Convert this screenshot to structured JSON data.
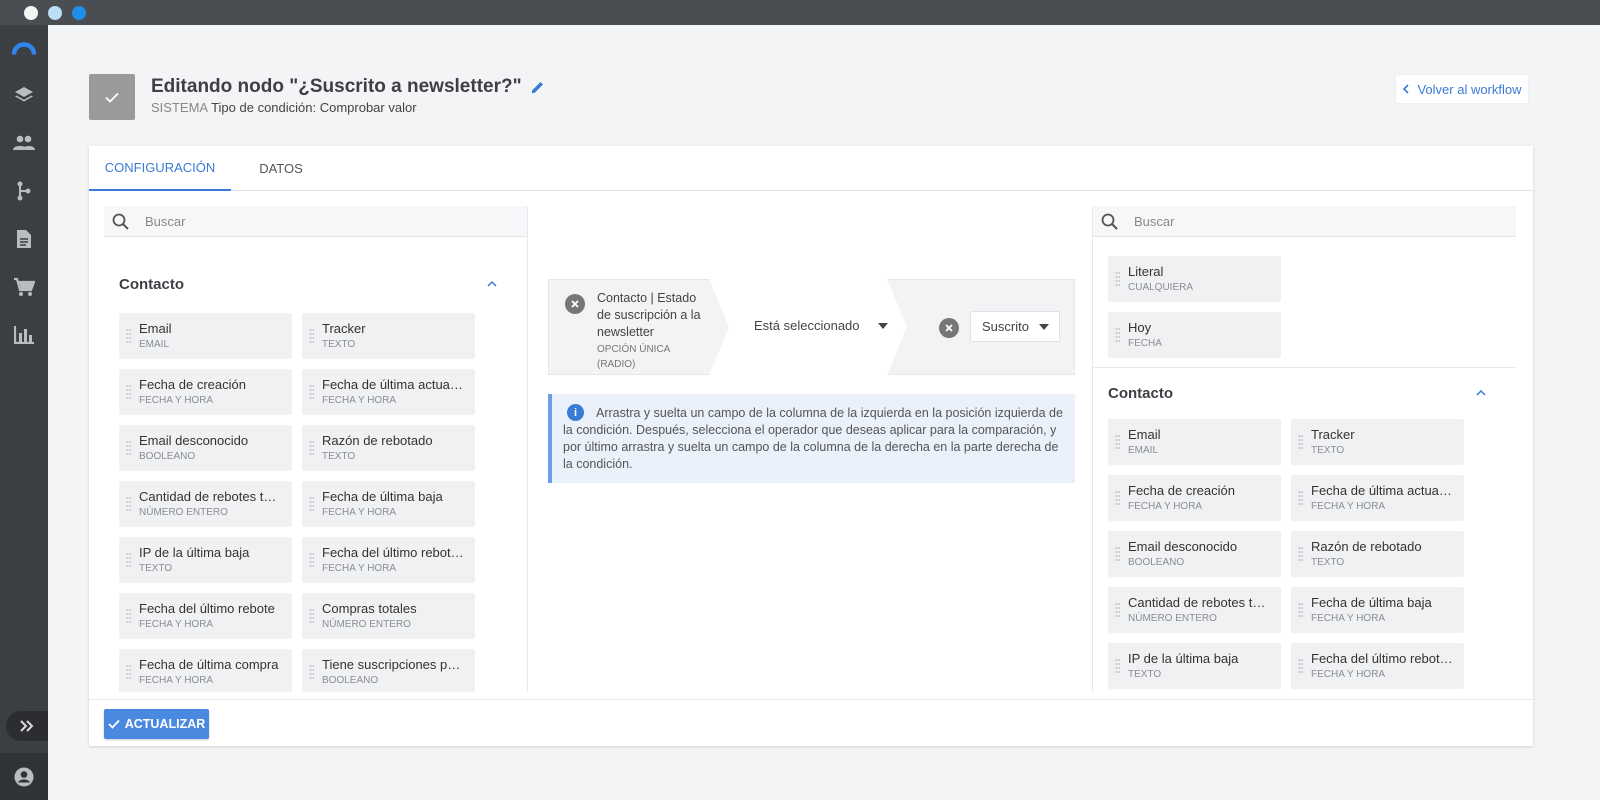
{
  "header": {
    "title": "Editando nodo \"¿Suscrito a newsletter?\"",
    "system_label": "SISTEMA",
    "condition_type": "Tipo de condición: Comprobar valor",
    "back_label": "Volver al workflow"
  },
  "tabs": [
    {
      "label": "CONFIGURACIÓN",
      "active": true
    },
    {
      "label": "DATOS",
      "active": false
    }
  ],
  "left_panel": {
    "search_placeholder": "Buscar",
    "group_title": "Contacto",
    "fields": [
      {
        "label": "Email",
        "type": "EMAIL"
      },
      {
        "label": "Tracker",
        "type": "TEXTO"
      },
      {
        "label": "Fecha de creación",
        "type": "FECHA Y HORA"
      },
      {
        "label": "Fecha de última actualización",
        "type": "FECHA Y HORA"
      },
      {
        "label": "Email desconocido",
        "type": "BOOLEANO"
      },
      {
        "label": "Razón de rebotado",
        "type": "TEXTO"
      },
      {
        "label": "Cantidad de rebotes temporales",
        "type": "NÚMERO ENTERO"
      },
      {
        "label": "Fecha de última baja",
        "type": "FECHA Y HORA"
      },
      {
        "label": "IP de la última baja",
        "type": "TEXTO"
      },
      {
        "label": "Fecha del último rebote temporal",
        "type": "FECHA Y HORA"
      },
      {
        "label": "Fecha del último rebote",
        "type": "FECHA Y HORA"
      },
      {
        "label": "Compras totales",
        "type": "NÚMERO ENTERO"
      },
      {
        "label": "Fecha de última compra",
        "type": "FECHA Y HORA"
      },
      {
        "label": "Tiene suscripciones pendientes",
        "type": "BOOLEANO"
      }
    ]
  },
  "condition": {
    "left_field": "Contacto | Estado de suscripción a la newsletter",
    "left_type": "OPCIÓN ÚNICA (RADIO)",
    "operator": "Está seleccionado",
    "value": "Suscrito"
  },
  "info_text": "Arrastra y suelta un campo de la columna de la izquierda en la posición izquierda de la condición. Después, selecciona el operador que deseas aplicar para la comparación, y por último arrastra y suelta un campo de la columna de la derecha en la parte derecha de la condición.",
  "right_panel": {
    "search_placeholder": "Buscar",
    "special_fields": [
      {
        "label": "Literal",
        "type": "CUALQUIERA"
      },
      {
        "label": "Hoy",
        "type": "FECHA"
      }
    ],
    "group_title": "Contacto",
    "fields": [
      {
        "label": "Email",
        "type": "EMAIL"
      },
      {
        "label": "Tracker",
        "type": "TEXTO"
      },
      {
        "label": "Fecha de creación",
        "type": "FECHA Y HORA"
      },
      {
        "label": "Fecha de última actualización",
        "type": "FECHA Y HORA"
      },
      {
        "label": "Email desconocido",
        "type": "BOOLEANO"
      },
      {
        "label": "Razón de rebotado",
        "type": "TEXTO"
      },
      {
        "label": "Cantidad de rebotes temporales",
        "type": "NÚMERO ENTERO"
      },
      {
        "label": "Fecha de última baja",
        "type": "FECHA Y HORA"
      },
      {
        "label": "IP de la última baja",
        "type": "TEXTO"
      },
      {
        "label": "Fecha del último rebote temporal",
        "type": "FECHA Y HORA"
      }
    ]
  },
  "footer": {
    "update_label": "ACTUALIZAR"
  },
  "colors": {
    "accent": "#3a7bd5",
    "sidebar": "#3b3e43",
    "titlebar": "#4a4d52"
  },
  "icons": {
    "sidebar": [
      "logo-icon",
      "layers-icon",
      "users-icon",
      "workflow-icon",
      "document-icon",
      "cart-icon",
      "chart-icon"
    ],
    "sidebar_toggle": "double-chevron-right-icon",
    "user": "user-circle-icon"
  }
}
